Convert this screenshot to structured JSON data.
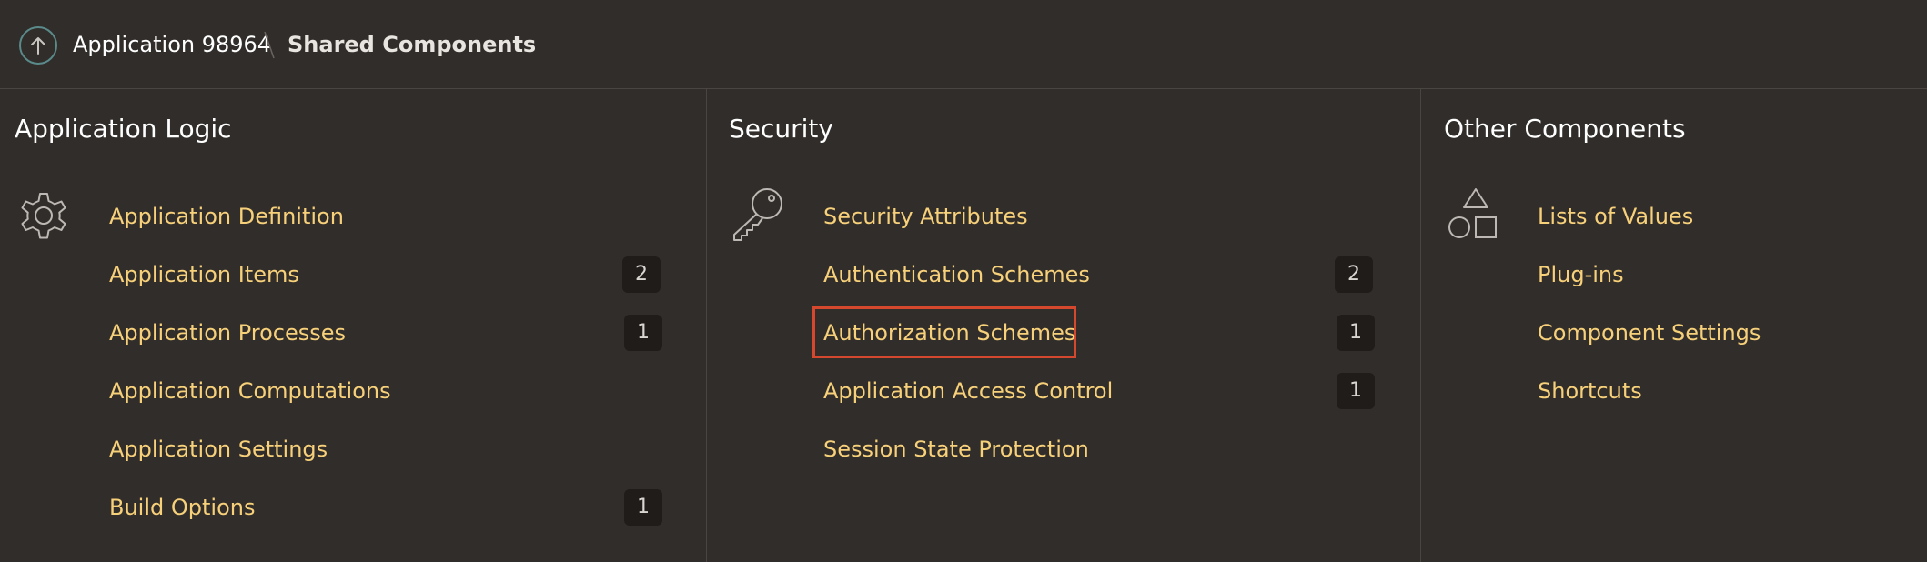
{
  "breadcrumb": {
    "app": "Application 98964",
    "current": "Shared Components"
  },
  "colors": {
    "background": "#312d2a",
    "link": "#f7d07a",
    "highlight": "#d6482e"
  },
  "columns": [
    {
      "title": "Application Logic",
      "icon": "gear-icon",
      "items": [
        {
          "label": "Application Definition",
          "count": null
        },
        {
          "label": "Application Items",
          "count": "2"
        },
        {
          "label": "Application Processes",
          "count": "1"
        },
        {
          "label": "Application Computations",
          "count": null
        },
        {
          "label": "Application Settings",
          "count": null
        },
        {
          "label": "Build Options",
          "count": "1"
        }
      ]
    },
    {
      "title": "Security",
      "icon": "key-icon",
      "items": [
        {
          "label": "Security Attributes",
          "count": null
        },
        {
          "label": "Authentication Schemes",
          "count": "2"
        },
        {
          "label": "Authorization Schemes",
          "count": "1",
          "highlighted": true
        },
        {
          "label": "Application Access Control",
          "count": "1"
        },
        {
          "label": "Session State Protection",
          "count": null
        }
      ]
    },
    {
      "title": "Other Components",
      "icon": "shapes-icon",
      "items": [
        {
          "label": "Lists of Values",
          "count": null
        },
        {
          "label": "Plug-ins",
          "count": null
        },
        {
          "label": "Component Settings",
          "count": null
        },
        {
          "label": "Shortcuts",
          "count": null
        }
      ]
    }
  ]
}
